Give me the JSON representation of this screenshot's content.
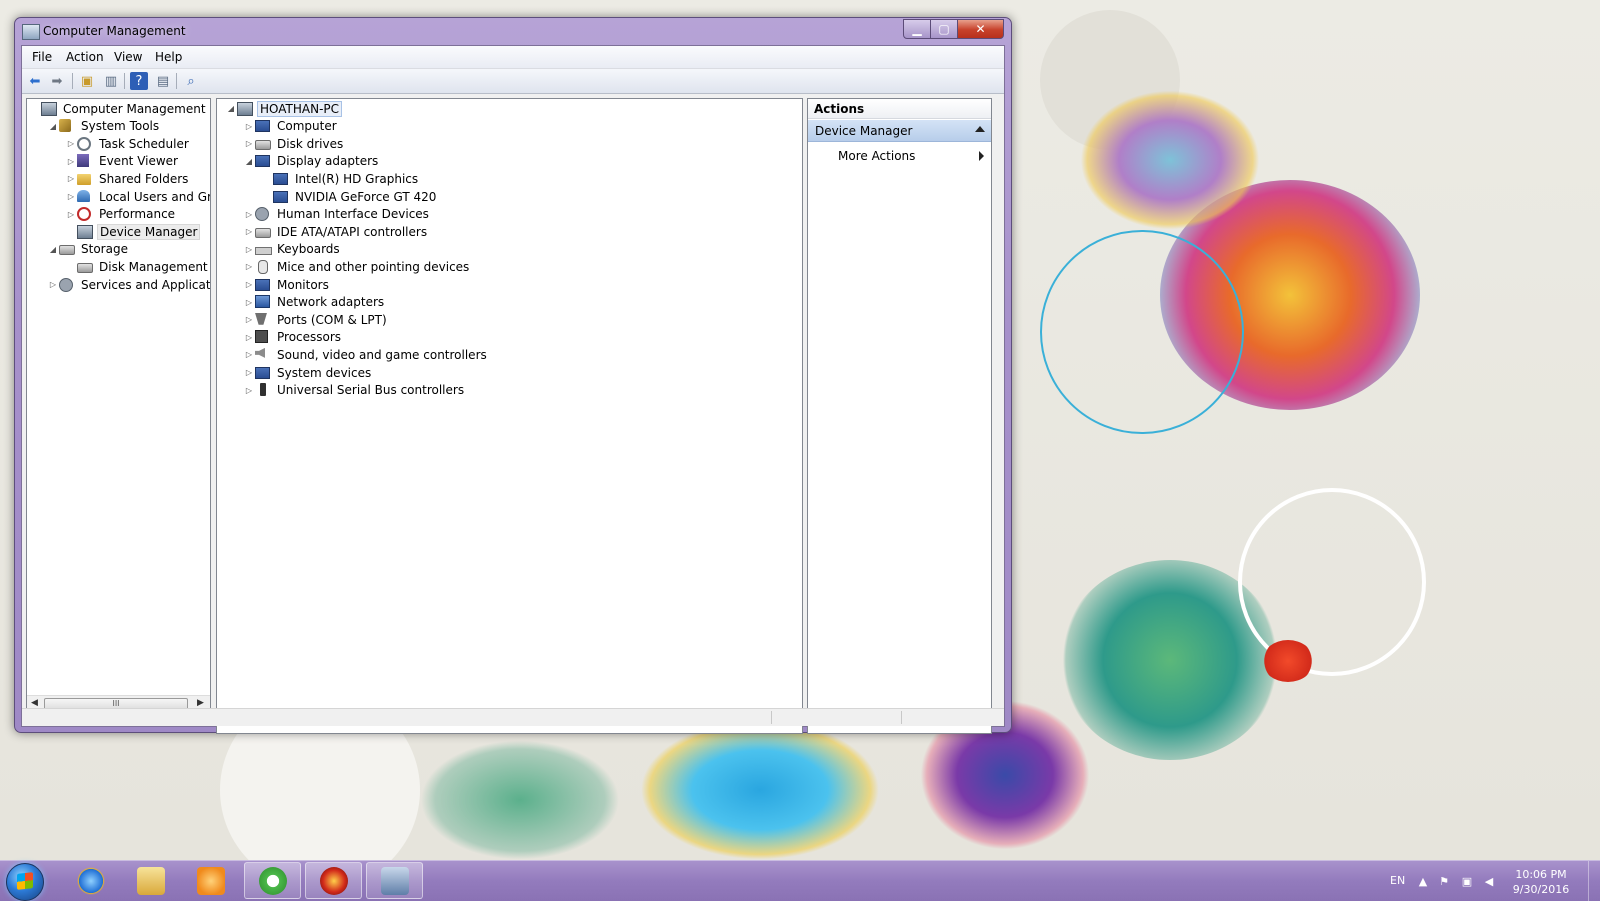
{
  "window": {
    "title": "Computer Management",
    "menu": [
      "File",
      "Action",
      "View",
      "Help"
    ]
  },
  "nav_tree": [
    {
      "label": "Computer Management (Local",
      "level": 0,
      "twisty": "",
      "icon": "pc-icon"
    },
    {
      "label": "System Tools",
      "level": 1,
      "twisty": "◢",
      "icon": "tools-icon"
    },
    {
      "label": "Task Scheduler",
      "level": 2,
      "twisty": "▷",
      "icon": "clock-icon"
    },
    {
      "label": "Event Viewer",
      "level": 2,
      "twisty": "▷",
      "icon": "event-viewer-icon"
    },
    {
      "label": "Shared Folders",
      "level": 2,
      "twisty": "▷",
      "icon": "shared-folder-icon"
    },
    {
      "label": "Local Users and Groups",
      "level": 2,
      "twisty": "▷",
      "icon": "users-icon"
    },
    {
      "label": "Performance",
      "level": 2,
      "twisty": "▷",
      "icon": "performance-icon"
    },
    {
      "label": "Device Manager",
      "level": 2,
      "twisty": "",
      "icon": "device-manager-icon",
      "selected": true
    },
    {
      "label": "Storage",
      "level": 1,
      "twisty": "◢",
      "icon": "storage-icon"
    },
    {
      "label": "Disk Management",
      "level": 2,
      "twisty": "",
      "icon": "disk-management-icon"
    },
    {
      "label": "Services and Applications",
      "level": 1,
      "twisty": "▷",
      "icon": "services-icon"
    }
  ],
  "device_tree": [
    {
      "label": "HOATHAN-PC",
      "level": 0,
      "twisty": "◢",
      "icon": "computer-icon",
      "root": true
    },
    {
      "label": "Computer",
      "level": 1,
      "twisty": "▷",
      "icon": "monitor-icon"
    },
    {
      "label": "Disk drives",
      "level": 1,
      "twisty": "▷",
      "icon": "disk-drive-icon"
    },
    {
      "label": "Display adapters",
      "level": 1,
      "twisty": "◢",
      "icon": "display-adapter-icon"
    },
    {
      "label": "Intel(R) HD Graphics",
      "level": 2,
      "twisty": "",
      "icon": "display-adapter-icon"
    },
    {
      "label": "NVIDIA GeForce GT 420",
      "level": 2,
      "twisty": "",
      "icon": "display-adapter-icon"
    },
    {
      "label": "Human Interface Devices",
      "level": 1,
      "twisty": "▷",
      "icon": "hid-icon"
    },
    {
      "label": "IDE ATA/ATAPI controllers",
      "level": 1,
      "twisty": "▷",
      "icon": "ide-controller-icon"
    },
    {
      "label": "Keyboards",
      "level": 1,
      "twisty": "▷",
      "icon": "keyboard-icon"
    },
    {
      "label": "Mice and other pointing devices",
      "level": 1,
      "twisty": "▷",
      "icon": "mouse-icon"
    },
    {
      "label": "Monitors",
      "level": 1,
      "twisty": "▷",
      "icon": "monitor-icon"
    },
    {
      "label": "Network adapters",
      "level": 1,
      "twisty": "▷",
      "icon": "network-adapter-icon"
    },
    {
      "label": "Ports (COM & LPT)",
      "level": 1,
      "twisty": "▷",
      "icon": "port-icon"
    },
    {
      "label": "Processors",
      "level": 1,
      "twisty": "▷",
      "icon": "processor-icon"
    },
    {
      "label": "Sound, video and game controllers",
      "level": 1,
      "twisty": "▷",
      "icon": "sound-icon"
    },
    {
      "label": "System devices",
      "level": 1,
      "twisty": "▷",
      "icon": "system-devices-icon"
    },
    {
      "label": "Universal Serial Bus controllers",
      "level": 1,
      "twisty": "▷",
      "icon": "usb-icon"
    }
  ],
  "actions": {
    "header": "Actions",
    "group": "Device Manager",
    "more": "More Actions"
  },
  "scrollbar": {
    "thumb_grip": "III",
    "left_arrow": "◀",
    "right_arrow": "▶"
  },
  "taskbar": {
    "language": "EN",
    "time": "10:06 PM",
    "date": "9/30/2016"
  },
  "colors": {
    "window_frame": "#a791cb",
    "taskbar": "#937bbd",
    "actions_group": "#c4d7f0"
  }
}
